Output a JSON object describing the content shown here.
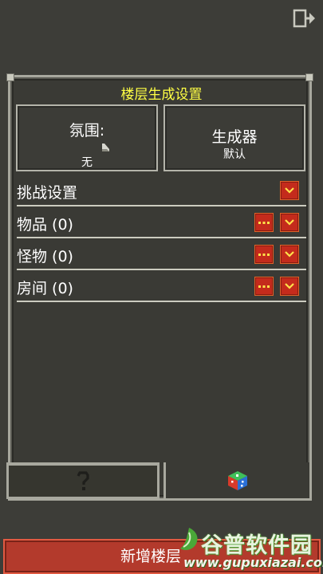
{
  "header": {
    "exit_icon": "exit-door-icon"
  },
  "panel": {
    "title": "楼层生成设置"
  },
  "cards": {
    "atmosphere": {
      "label": "氛围:",
      "value": "无",
      "icon": "floor-tile-icon"
    },
    "generator": {
      "label": "生成器",
      "value": "默认"
    }
  },
  "rows": [
    {
      "label": "挑战设置",
      "has_more": false
    },
    {
      "label": "物品 (0)",
      "has_more": true
    },
    {
      "label": "怪物 (0)",
      "has_more": true
    },
    {
      "label": "房间 (0)",
      "has_more": true
    }
  ],
  "tabs": {
    "help_icon": "question-mark-icon",
    "dice_icon": "dice-icon"
  },
  "footer": {
    "new_floor_label": "新增楼层"
  },
  "watermark": {
    "title": "谷普软件园",
    "url": "www.gupuxiazai.com"
  },
  "colors": {
    "title_yellow": "#ffff44",
    "button_red": "#c42b1c",
    "border": "#a8a89e"
  }
}
